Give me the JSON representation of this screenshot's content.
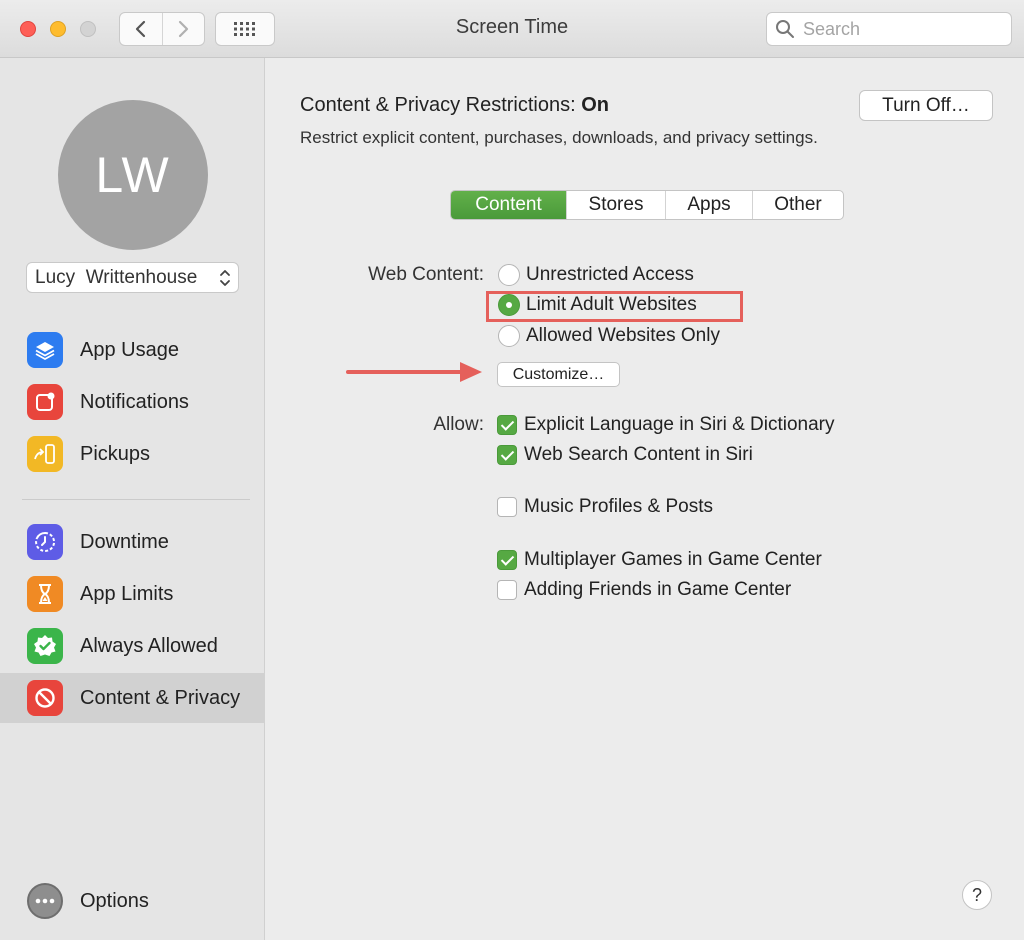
{
  "window": {
    "title": "Screen Time"
  },
  "search": {
    "placeholder": "Search"
  },
  "user": {
    "initials": "LW",
    "name": "Lucy  Writtenhouse"
  },
  "sidebar": {
    "items": [
      {
        "label": "App Usage",
        "icon": "layers-icon",
        "color": "#2d7cf0"
      },
      {
        "label": "Notifications",
        "icon": "notification-icon",
        "color": "#e8453c"
      },
      {
        "label": "Pickups",
        "icon": "pickup-icon",
        "color": "#f2b825"
      },
      {
        "label": "Downtime",
        "icon": "downtime-icon",
        "color": "#5e5ce6"
      },
      {
        "label": "App Limits",
        "icon": "hourglass-icon",
        "color": "#f08a24"
      },
      {
        "label": "Always Allowed",
        "icon": "checkmark-badge-icon",
        "color": "#3bb54a"
      },
      {
        "label": "Content & Privacy",
        "icon": "no-entry-icon",
        "color": "#e8453c",
        "selected": true
      }
    ],
    "options_label": "Options"
  },
  "main": {
    "heading_prefix": "Content & Privacy Restrictions:",
    "heading_status": "On",
    "subheading": "Restrict explicit content, purchases, downloads, and privacy settings.",
    "turn_off_label": "Turn Off…",
    "tabs": [
      {
        "label": "Content",
        "active": true
      },
      {
        "label": "Stores",
        "active": false
      },
      {
        "label": "Apps",
        "active": false
      },
      {
        "label": "Other",
        "active": false
      }
    ],
    "web_content": {
      "label": "Web Content:",
      "options": [
        {
          "label": "Unrestricted Access",
          "selected": false
        },
        {
          "label": "Limit Adult Websites",
          "selected": true
        },
        {
          "label": "Allowed Websites Only",
          "selected": false
        }
      ],
      "customize_label": "Customize…"
    },
    "allow": {
      "label": "Allow:",
      "items": [
        {
          "label": "Explicit Language in Siri & Dictionary",
          "checked": true
        },
        {
          "label": "Web Search Content in Siri",
          "checked": true
        },
        {
          "label": "Music Profiles & Posts",
          "checked": false
        },
        {
          "label": "Multiplayer Games in Game Center",
          "checked": true
        },
        {
          "label": "Adding Friends in Game Center",
          "checked": false
        }
      ]
    },
    "help_label": "?"
  },
  "colors": {
    "accent_green": "#56a943",
    "annotation_red": "#e5605b"
  }
}
